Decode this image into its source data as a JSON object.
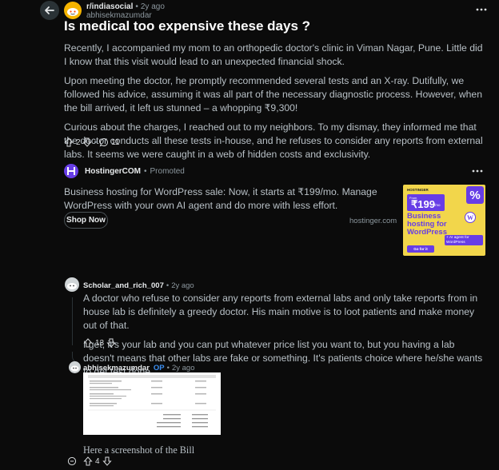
{
  "post": {
    "subreddit": "r/indiasocial",
    "age": "2y ago",
    "author": "abhisekmazumdar",
    "title": "Is medical too expensive these days ?",
    "paragraphs": [
      "Recently, I accompanied my mom to an orthopedic doctor's clinic in Viman Nagar, Pune. Little did I know that this visit would lead to an unexpected financial shock.",
      "Upon meeting the doctor, he promptly recommended several tests and an X-ray. Dutifully, we followed his advice, assuming it was all part of the necessary diagnostic process. However, when the bill arrived, it left us stunned – a whopping ₹9,300!",
      "Curious about the charges, I reached out to my neighbors. To my dismay, they informed me that the doctor conducts all these tests in-house, and he refuses to consider any reports from external labs. It seems we were caught in a web of hidden costs and exclusivity."
    ],
    "votes": "2",
    "comments": "11"
  },
  "ad": {
    "advertiser": "HostingerCOM",
    "promoted": "Promoted",
    "text": "Business hosting for WordPress sale: Now, it starts at ₹199/mo. Manage WordPress with your own AI agent and do more with less effort.",
    "cta": "Shop Now",
    "domain": "hostinger.com",
    "image": {
      "brand": "HOSTINGER",
      "from": "From",
      "price": "₹199",
      "per": "/mo",
      "percent": "%",
      "headline": "Business hosting for WordPress",
      "tagline": "+ AI agent for WordPress",
      "go": "Go for it"
    }
  },
  "comments": [
    {
      "author": "Scholar_and_rich_007",
      "age": "2y ago",
      "paragraphs": [
        "A doctor who refuse to consider any reports from external labs and only take reports from in house lab is definitely a greedy doctor. His main motive is to loot patients and make money out of that.",
        "I get, it's your lab and you can put whatever price list you want to, but you having a lab doesn't means that other labs are fake or something. It's patients choice where he/she wants to get test done."
      ],
      "votes": "13"
    },
    {
      "author": "abhisekmazumdar",
      "op_badge": "OP",
      "age": "2y ago",
      "text": "Here a screenshot of the Bill",
      "votes": "4"
    }
  ],
  "colors": {
    "background": "#0b0b0b",
    "title": "#ffffff",
    "body": "#b8c0c6",
    "op_badge": "#3b8ef0",
    "ad_image_bg": "#f2d64b",
    "ad_brand_purple": "#673de6"
  }
}
